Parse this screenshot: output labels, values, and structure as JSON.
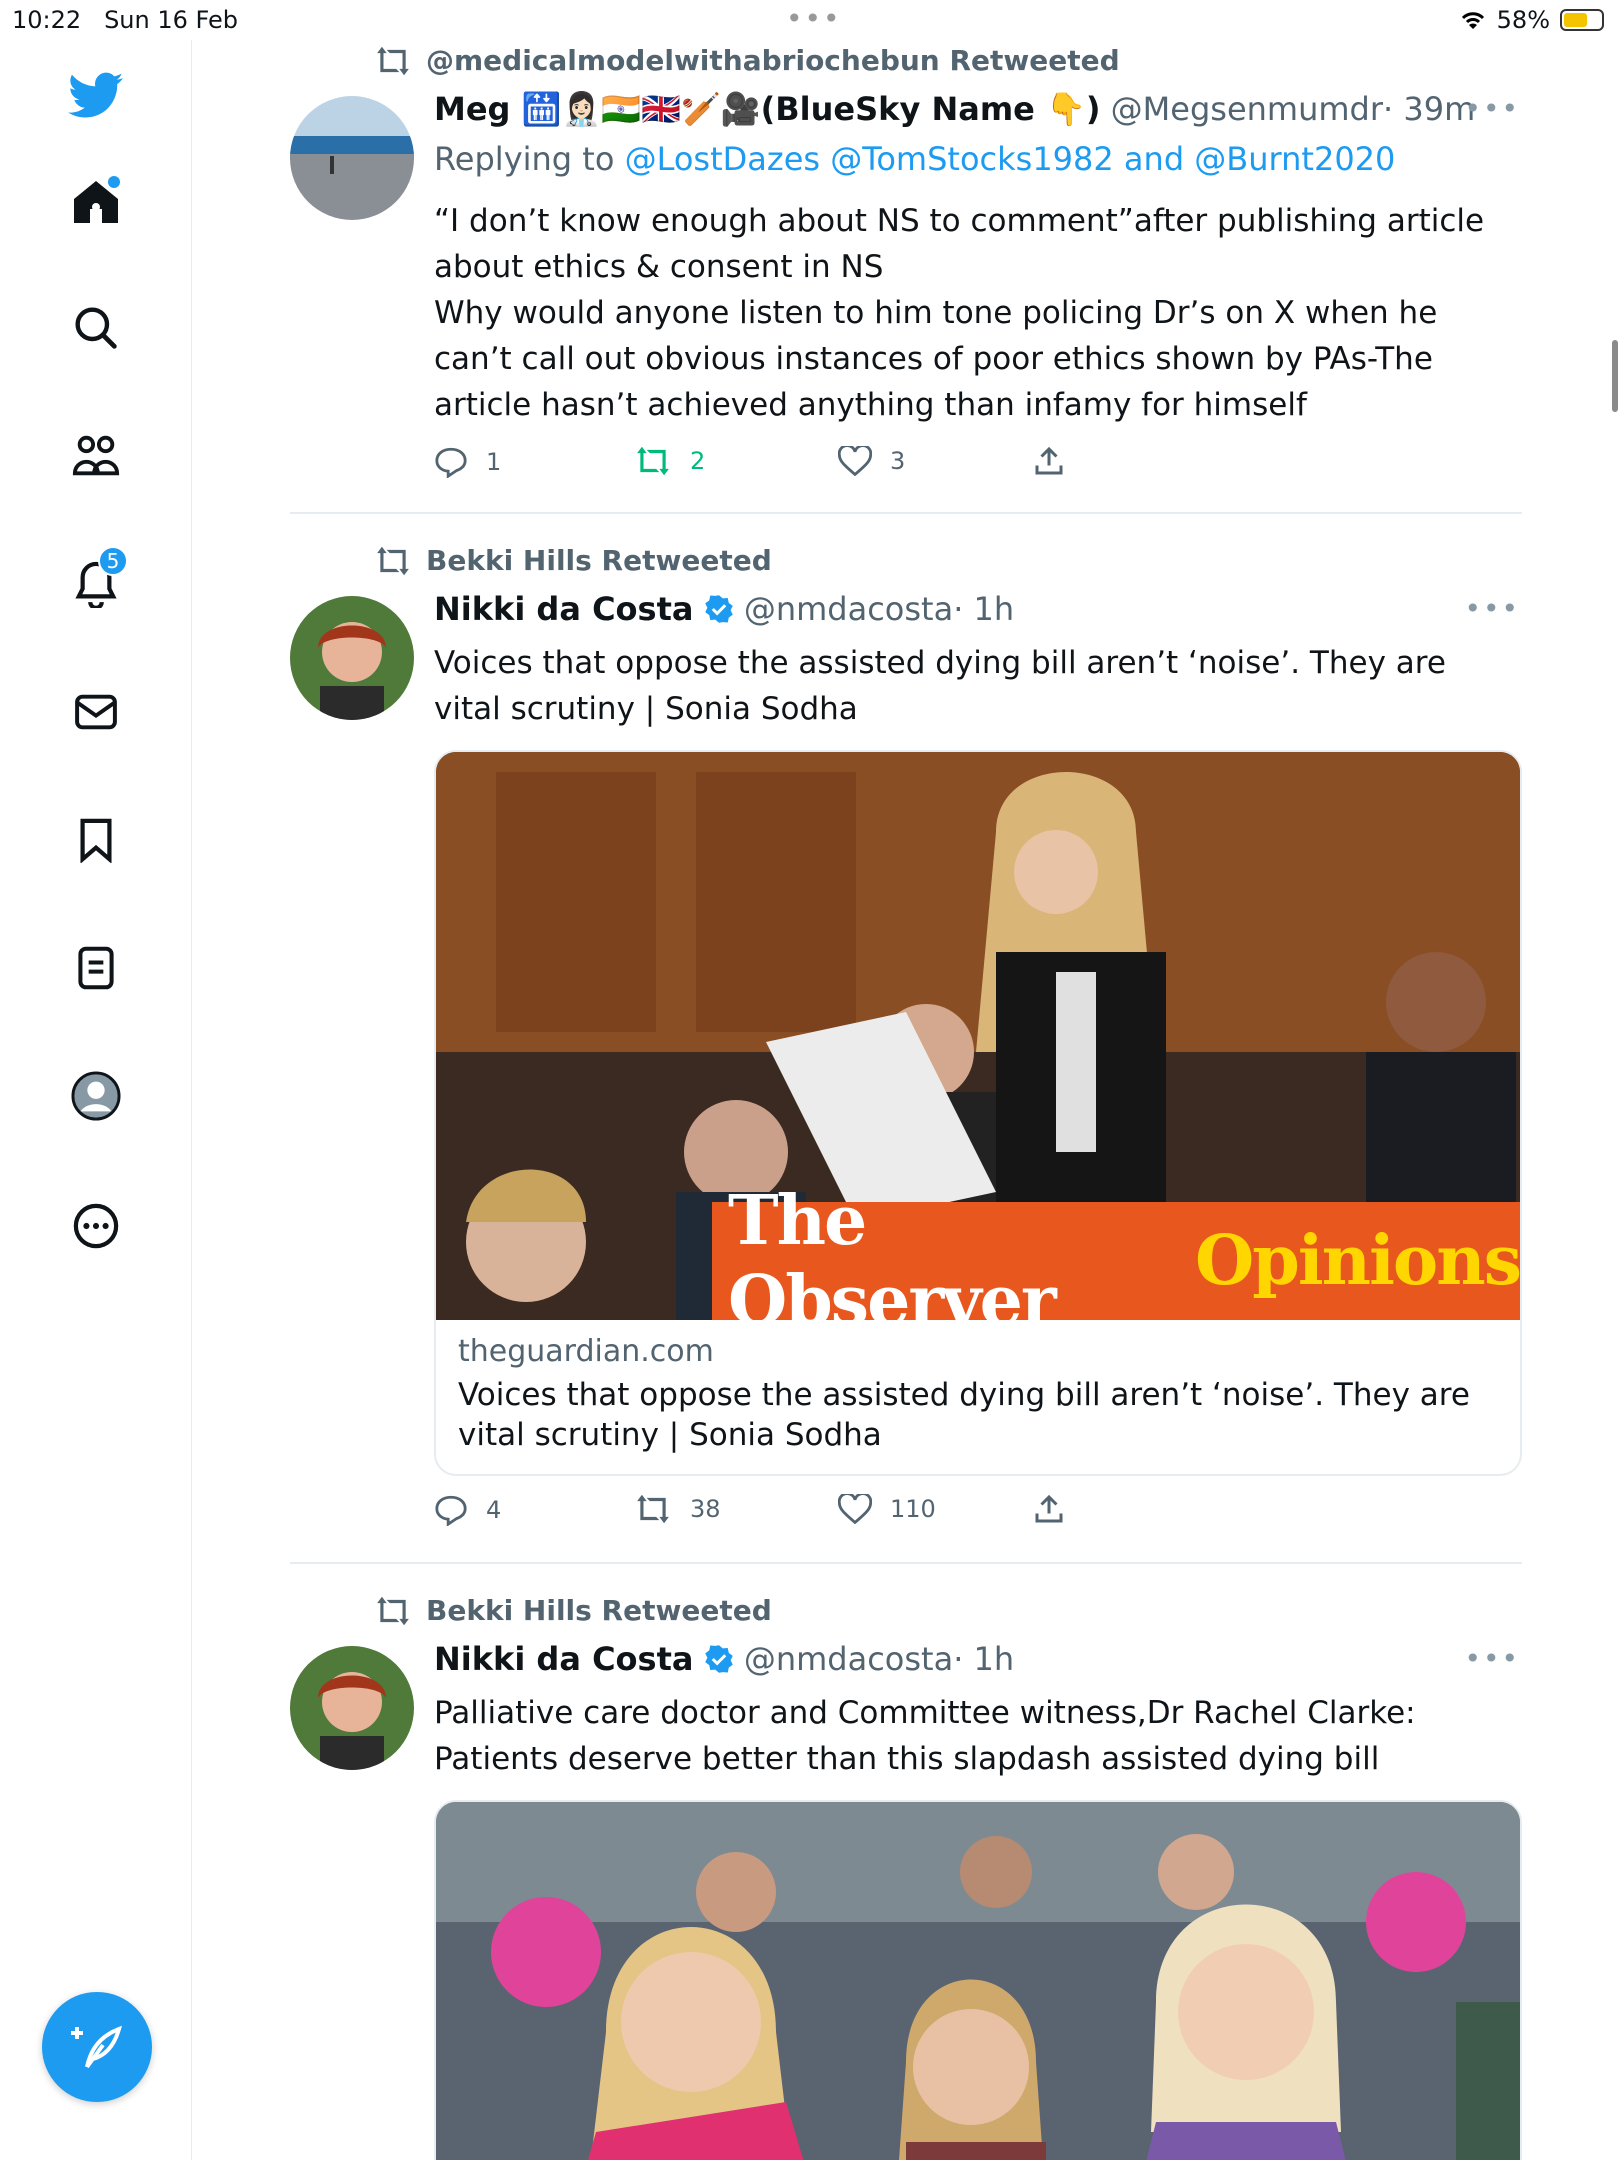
{
  "status_bar": {
    "time": "10:22",
    "date": "Sun 16 Feb",
    "battery": "58%",
    "battery_level": 0.58
  },
  "sidebar": {
    "items": [
      {
        "name": "home",
        "icon": "home-icon"
      },
      {
        "name": "explore",
        "icon": "search-icon"
      },
      {
        "name": "communities",
        "icon": "communities-icon"
      },
      {
        "name": "notifications",
        "icon": "bell-icon",
        "badge": "5"
      },
      {
        "name": "messages",
        "icon": "mail-icon"
      },
      {
        "name": "bookmarks",
        "icon": "bookmark-icon"
      },
      {
        "name": "lists",
        "icon": "list-icon"
      },
      {
        "name": "profile",
        "icon": "avatar-icon"
      },
      {
        "name": "more",
        "icon": "more-icon"
      }
    ],
    "compose_icon": "compose-tweet-icon"
  },
  "tweets": [
    {
      "retweeted_by": "@medicalmodelwithabriochebun Retweeted",
      "name": "Meg 🛗👩🏻‍⚕️🇮🇳🇬🇧🏏🎥(BlueSky Name 👇)",
      "handle": "@Megsenmumdr",
      "time": "· 39m",
      "replying_prefix": "Replying to",
      "replying_to": "@LostDazes @TomStocks1982 and @Burnt2020",
      "text": "“I don’t know enough about NS to comment”after publishing article about ethics & consent in NS\nWhy would anyone listen to him tone policing Dr’s on X when he can’t call out obvious instances of poor ethics shown by PAs-The article hasn’t achieved anything than infamy for himself",
      "replies": "1",
      "retweets": "2",
      "likes": "3",
      "retweeted_by_me": true
    },
    {
      "retweeted_by": "Bekki Hills Retweeted",
      "name": "Nikki da Costa",
      "verified": true,
      "handle": "@nmdacosta",
      "time": "· 1h",
      "text": "Voices that oppose the assisted dying bill aren’t ‘noise’. They are vital scrutiny | Sonia Sodha",
      "card": {
        "banner_part1": "The Observer",
        "banner_part2": "Opinions",
        "domain": "theguardian.com",
        "title": "Voices that oppose the assisted dying bill aren’t ‘noise’. They are vital scrutiny | Sonia Sodha"
      },
      "replies": "4",
      "retweets": "38",
      "likes": "110"
    },
    {
      "retweeted_by": "Bekki Hills Retweeted",
      "name": "Nikki da Costa",
      "verified": true,
      "handle": "@nmdacosta",
      "time": "· 1h",
      "text": "Palliative care doctor and Committee witness,Dr Rachel Clarke: Patients deserve better than this slapdash assisted dying bill"
    }
  ],
  "colors": {
    "accent": "#1d9bf0",
    "retweet_green": "#00ba7c",
    "muted": "#536471",
    "observer_orange": "#e8571e",
    "observer_yellow": "#ffd600"
  }
}
